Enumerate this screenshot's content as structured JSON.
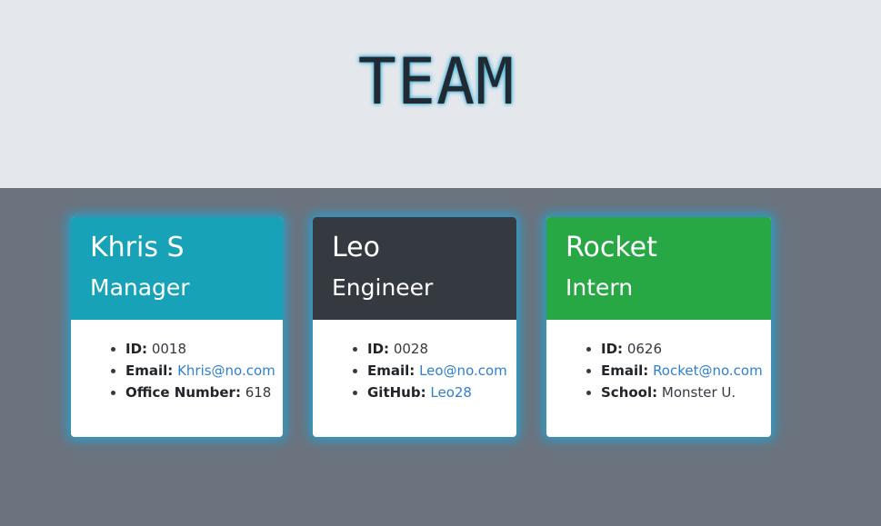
{
  "header": {
    "title": "TEAM"
  },
  "cards": [
    {
      "name": "Khris S",
      "role": "Manager",
      "header_color": "#17a2b8",
      "fields": [
        {
          "label": "ID:",
          "value": "0018"
        },
        {
          "label": "Email:",
          "value": "Khris@no.com"
        },
        {
          "label": "Office Number:",
          "value": "618"
        }
      ]
    },
    {
      "name": "Leo",
      "role": "Engineer",
      "header_color": "#343a40",
      "fields": [
        {
          "label": "ID:",
          "value": "0028"
        },
        {
          "label": "Email:",
          "value": "Leo@no.com"
        },
        {
          "label": "GitHub:",
          "value": "Leo28"
        }
      ]
    },
    {
      "name": "Rocket",
      "role": "Intern",
      "header_color": "#28a745",
      "fields": [
        {
          "label": "ID:",
          "value": "0626"
        },
        {
          "label": "Email:",
          "value": "Rocket@no.com"
        },
        {
          "label": "School:",
          "value": "Monster U."
        }
      ]
    }
  ],
  "colors": {
    "header_background": "#e4e8ec",
    "page_background": "#6b737e",
    "link": "#2f7fd1",
    "glow": "#1ea5d7"
  }
}
